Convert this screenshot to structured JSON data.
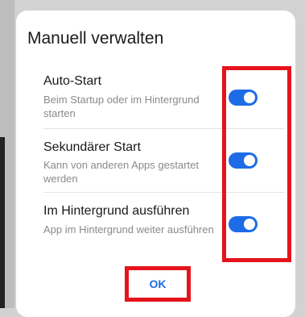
{
  "dialog": {
    "title": "Manuell verwalten",
    "items": [
      {
        "label": "Auto-Start",
        "description": "Beim Startup oder im Hintergrund starten",
        "enabled": true
      },
      {
        "label": "Sekundärer Start",
        "description": "Kann von anderen Apps gestartet werden",
        "enabled": true
      },
      {
        "label": "Im Hintergrund ausführen",
        "description": "App im Hintergrund weiter ausführen",
        "enabled": true
      }
    ],
    "ok_label": "OK"
  },
  "colors": {
    "accent": "#1e6be6",
    "highlight": "#e5141c",
    "dialog_bg": "#ffffff",
    "backdrop": "#d2d2d2"
  }
}
